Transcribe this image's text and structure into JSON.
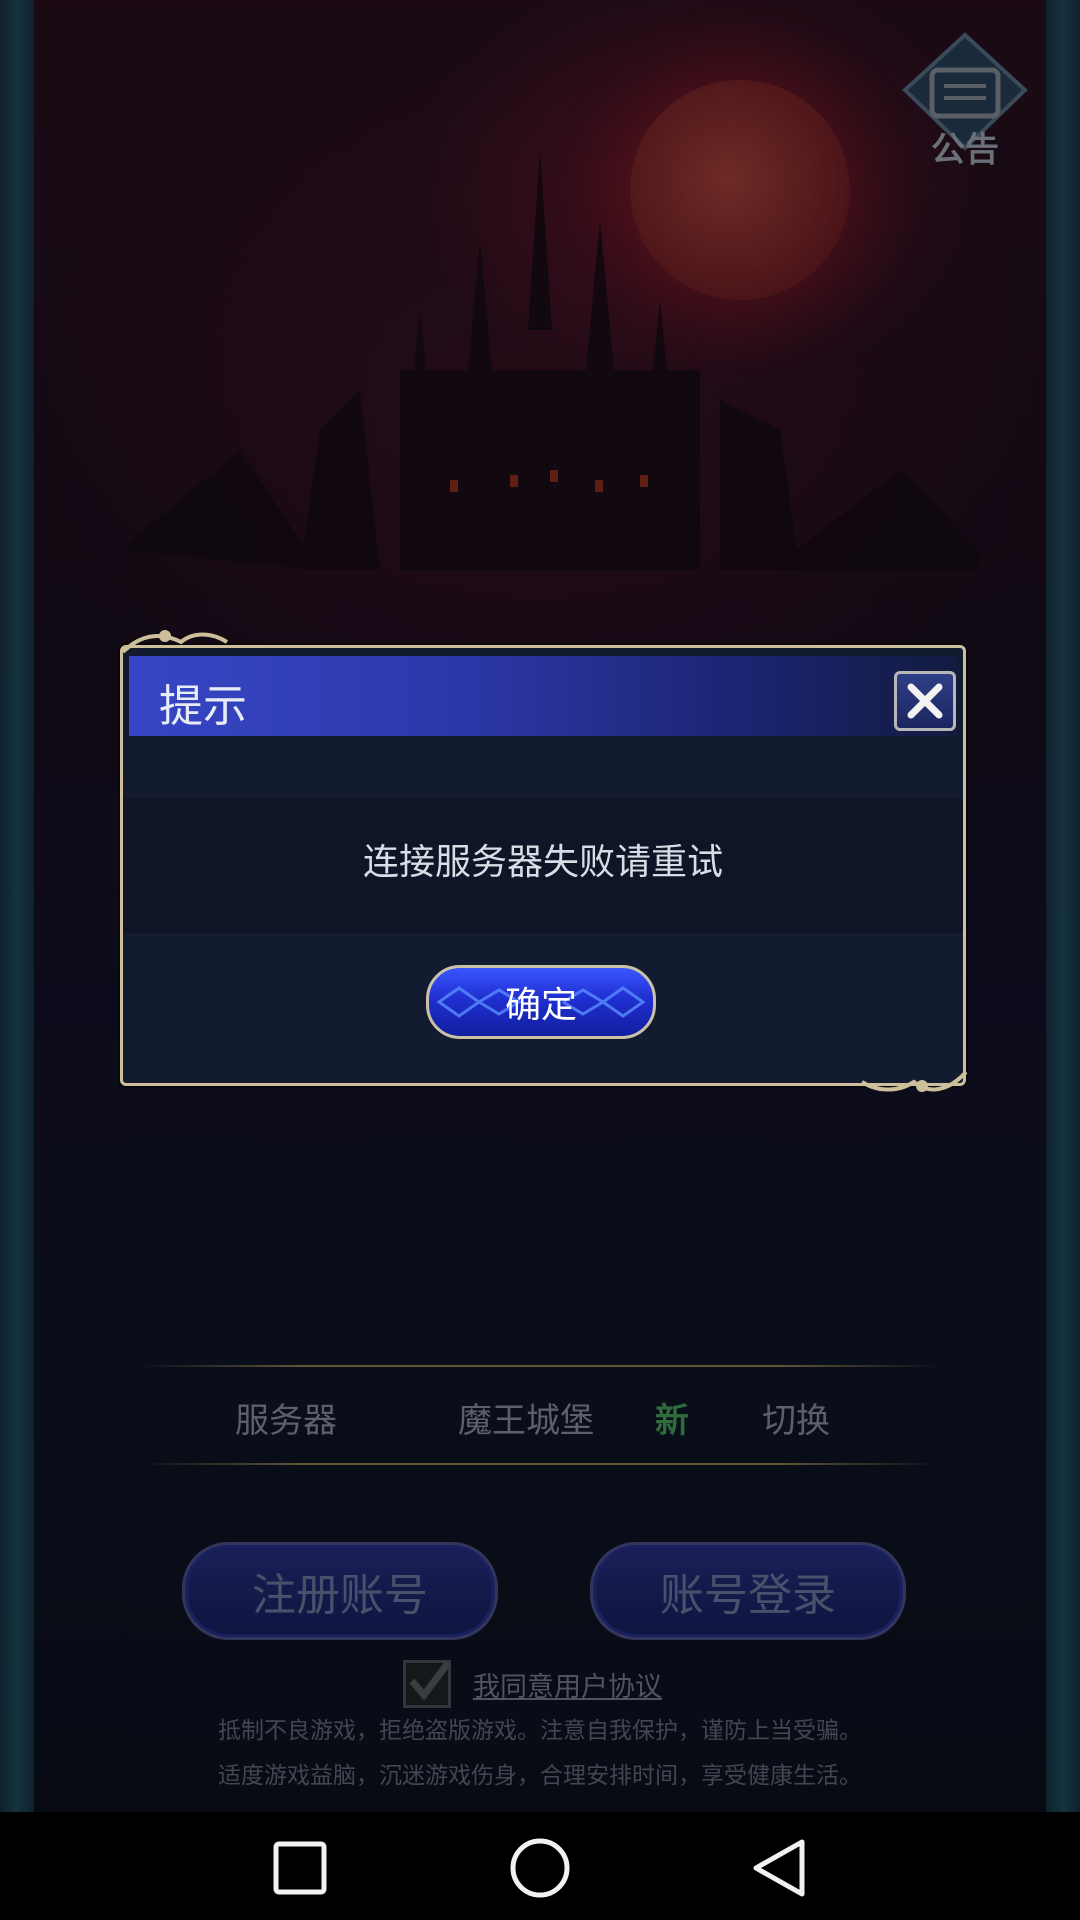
{
  "notice": {
    "label": "公告",
    "icon": "notice-board-icon"
  },
  "server": {
    "label": "服务器",
    "name": "魔王城堡",
    "badge": "新",
    "switch_label": "切换"
  },
  "buttons": {
    "register": "注册账号",
    "login": "账号登录"
  },
  "agreement": {
    "checked": true,
    "text": "我同意用户协议"
  },
  "health_notice": {
    "line1": "抵制不良游戏，拒绝盗版游戏。注意自我保护，谨防上当受骗。",
    "line2": "适度游戏益脑，沉迷游戏伤身，合理安排时间，享受健康生活。"
  },
  "dialog": {
    "title": "提示",
    "message": "连接服务器失败请重试",
    "ok_label": "确定",
    "colors": {
      "header": "#3746c6",
      "border": "#cdbf9a",
      "body": "#131b30"
    }
  },
  "navbar": {
    "recent_icon": "square-icon",
    "home_icon": "circle-icon",
    "back_icon": "triangle-back-icon"
  }
}
